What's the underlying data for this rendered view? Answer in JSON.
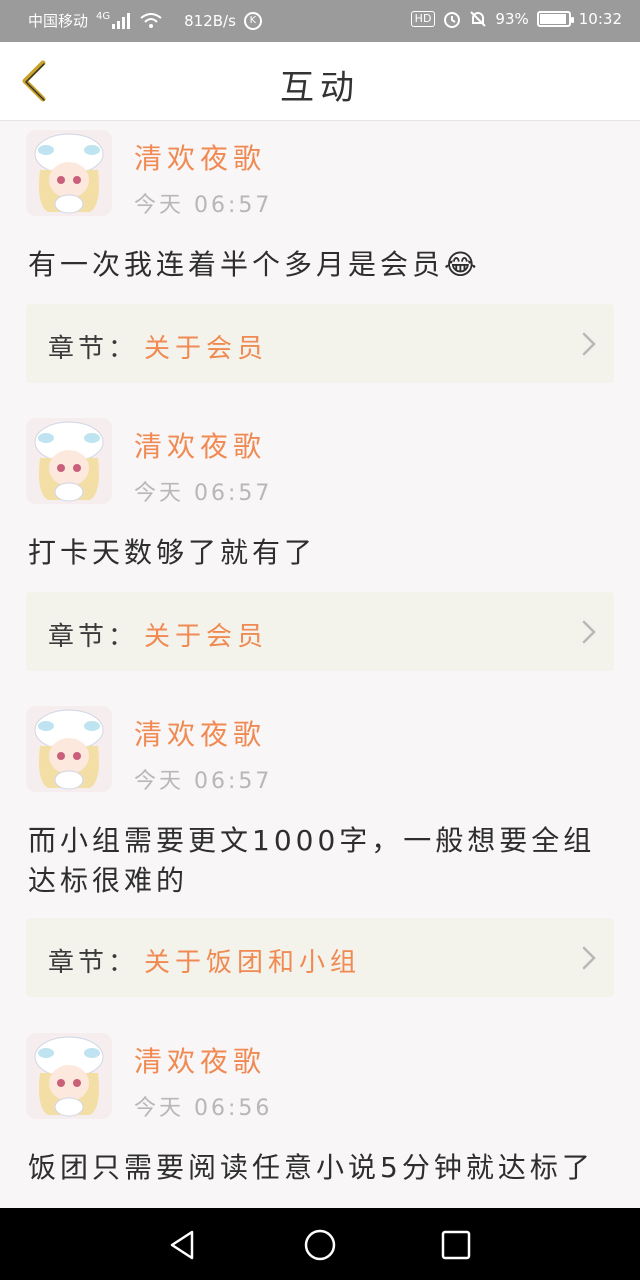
{
  "status_bar": {
    "carrier": "中国移动",
    "network": "4G",
    "speed": "812B/s",
    "app_icon": "K",
    "hd": "HD",
    "battery": "93%",
    "battery_level": 0.93,
    "time": "10:32"
  },
  "header": {
    "title": "互动"
  },
  "comments": [
    {
      "user": "清欢夜歌",
      "time": "今天 06:57",
      "text": "有一次我连着半个多月是会员😂",
      "chapter_label": "章节：",
      "chapter_name": "关于会员"
    },
    {
      "user": "清欢夜歌",
      "time": "今天 06:57",
      "text": "打卡天数够了就有了",
      "chapter_label": "章节：",
      "chapter_name": "关于会员"
    },
    {
      "user": "清欢夜歌",
      "time": "今天 06:57",
      "text": "而小组需要更文1000字，一般想要全组达标很难的",
      "chapter_label": "章节：",
      "chapter_name": "关于饭团和小组"
    },
    {
      "user": "清欢夜歌",
      "time": "今天 06:56",
      "text": "饭团只需要阅读任意小说5分钟就达标了"
    }
  ],
  "icons": {
    "back": "chevron-left-icon",
    "chapter_arrow": "chevron-right-icon",
    "nav_back": "triangle-back-icon",
    "nav_home": "circle-home-icon",
    "nav_recent": "square-recent-icon"
  },
  "colors": {
    "accent": "#f08a52",
    "back_icon": "#c9a227",
    "chapter_bg": "#f3f3ec"
  }
}
